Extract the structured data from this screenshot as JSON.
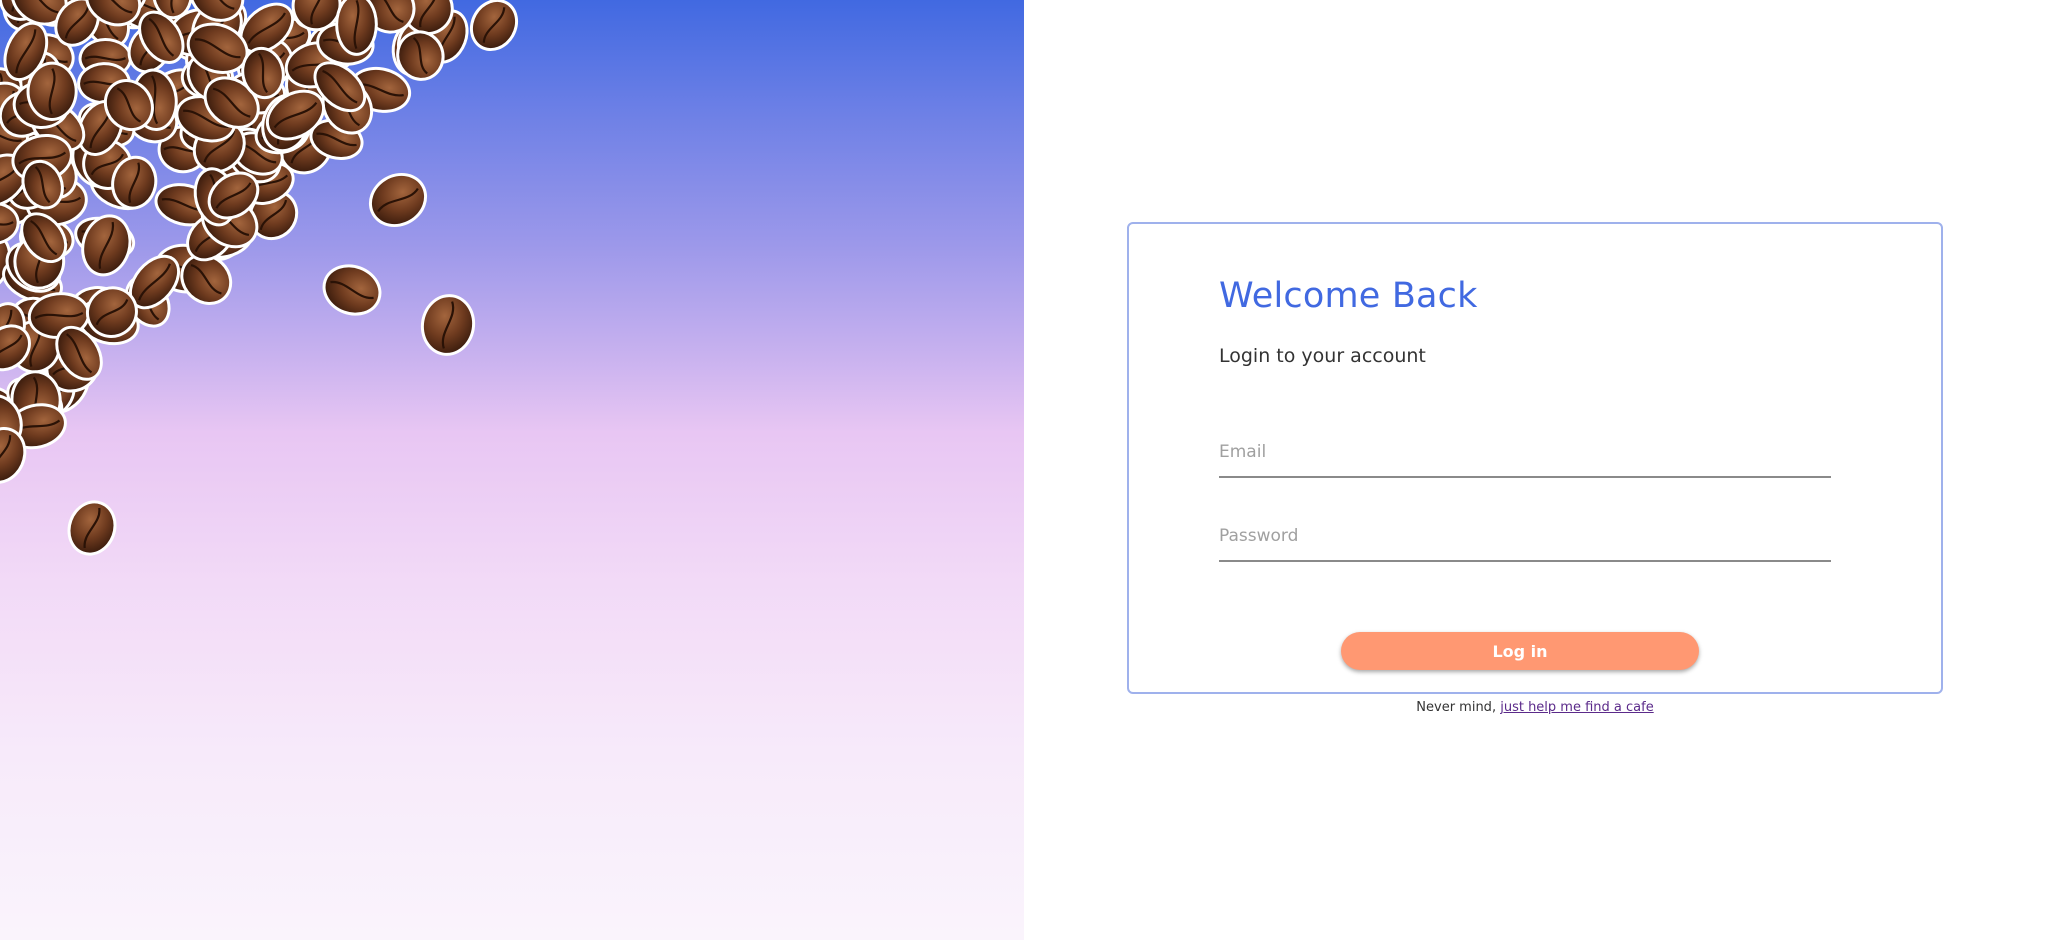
{
  "hero": {
    "image": "coffee-beans",
    "gradient_top": "#4169e1",
    "gradient_mid": "#e8c6f3",
    "gradient_bottom": "#faf4fc"
  },
  "login": {
    "title": "Welcome Back",
    "subtitle": "Login to your account",
    "email_placeholder": "Email",
    "password_placeholder": "Password",
    "button_label": "Log in",
    "accent_color": "#4169e1",
    "button_color": "#ff9872"
  },
  "footer": {
    "prefix": "Never mind,",
    "link_text": "just help me find a cafe"
  }
}
